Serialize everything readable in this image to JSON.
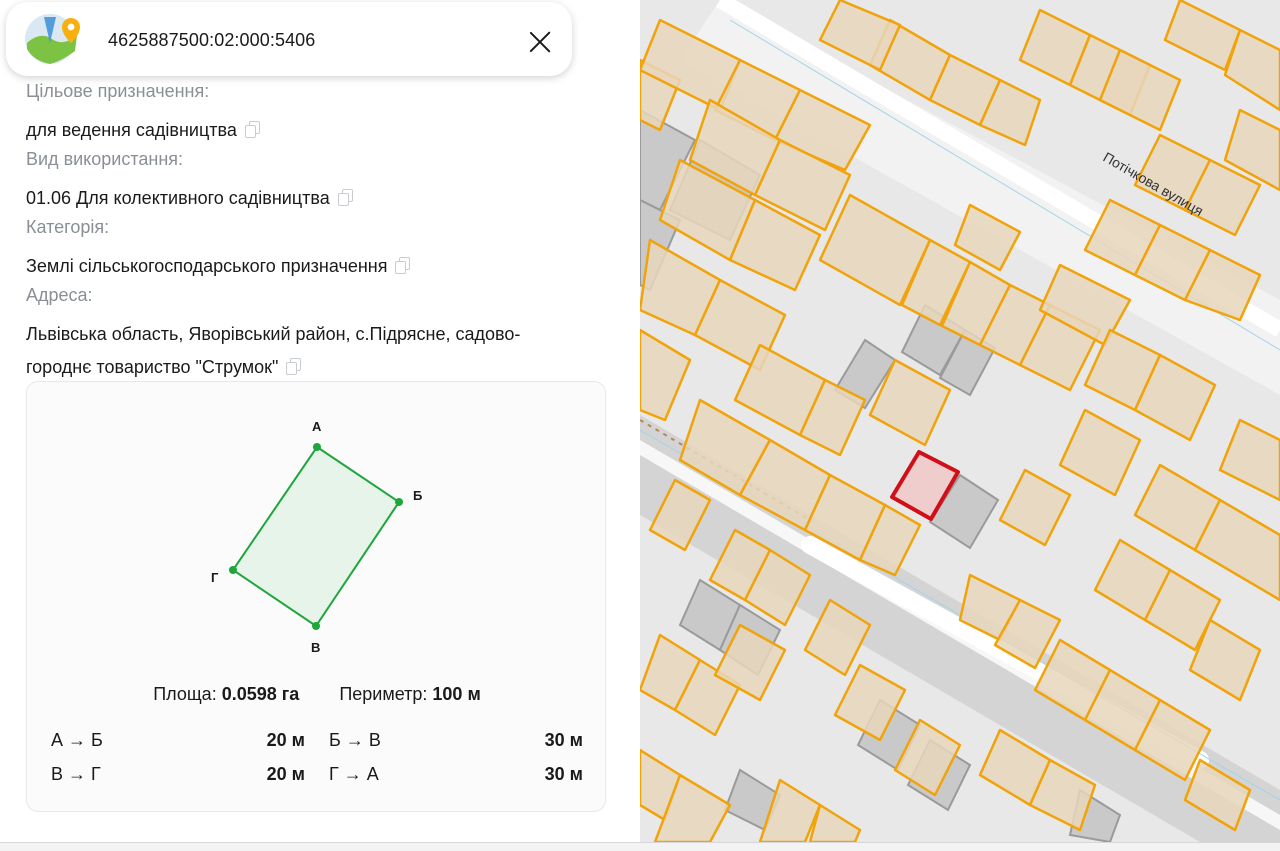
{
  "header": {
    "cadastral_number": "4625887500:02:000:5406"
  },
  "fields": [
    {
      "label": "Цільове призначення:",
      "value": "для ведення садівництва"
    },
    {
      "label": "Вид використання:",
      "value": "01.06 Для колективного садівництва"
    },
    {
      "label": "Категорія:",
      "value": "Землі сільськогосподарського призначення"
    },
    {
      "label": "Адреса:",
      "value_line1": "Львівська область, Яворівський район, с.Підрясне, садово-",
      "value_line2": "городнє товариство \"Струмок\""
    }
  ],
  "geometry": {
    "vertices": [
      {
        "name": "А"
      },
      {
        "name": "Б"
      },
      {
        "name": "В"
      },
      {
        "name": "Г"
      }
    ],
    "area_label": "Площа:",
    "area_value": "0.0598 га",
    "perimeter_label": "Периметр:",
    "perimeter_value": "100 м",
    "sides": [
      {
        "name": "А → Б",
        "length": "20 м"
      },
      {
        "name": "Б → В",
        "length": "30 м"
      },
      {
        "name": "В → Г",
        "length": "20 м"
      },
      {
        "name": "Г → А",
        "length": "30 м"
      }
    ]
  },
  "map": {
    "street_name": "Потічкова вулиця"
  },
  "colors": {
    "parcel_outline": "#f0a30a",
    "parcel_fill": "#e8d6bc",
    "selected_outline": "#d10f18",
    "polygon_green": "#1ea53c",
    "label_gray": "#8a8f96"
  },
  "icons": {
    "logo": "map-pin-logo-icon",
    "close": "close-icon",
    "copy": "copy-icon"
  }
}
